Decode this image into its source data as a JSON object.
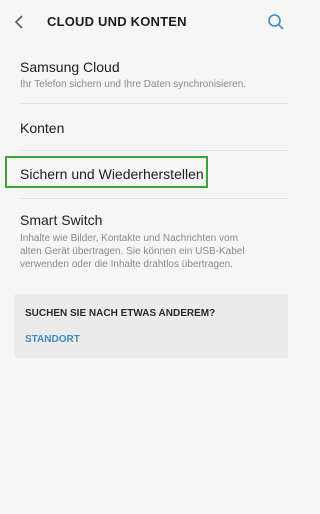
{
  "header": {
    "title": "CLOUD UND KONTEN"
  },
  "items": [
    {
      "title": "Samsung Cloud",
      "description": "Ihr Telefon sichern und Ihre Daten synchronisieren."
    },
    {
      "title": "Konten"
    },
    {
      "title": "Sichern und Wiederherstellen"
    },
    {
      "title": "Smart Switch",
      "description_lines": [
        "Inhalte wie Bilder, Kontakte und Nachrichten vom",
        "alten Gerät übertragen. Sie können ein USB-Kabel",
        "verwenden oder die Inhalte drahtlos übertragen."
      ]
    }
  ],
  "suggestion_card": {
    "title": "SUCHEN SIE NACH ETWAS ANDEREM?",
    "link": "STANDORT"
  },
  "colors": {
    "highlight": "#3aa535",
    "link": "#3a8fbd"
  }
}
